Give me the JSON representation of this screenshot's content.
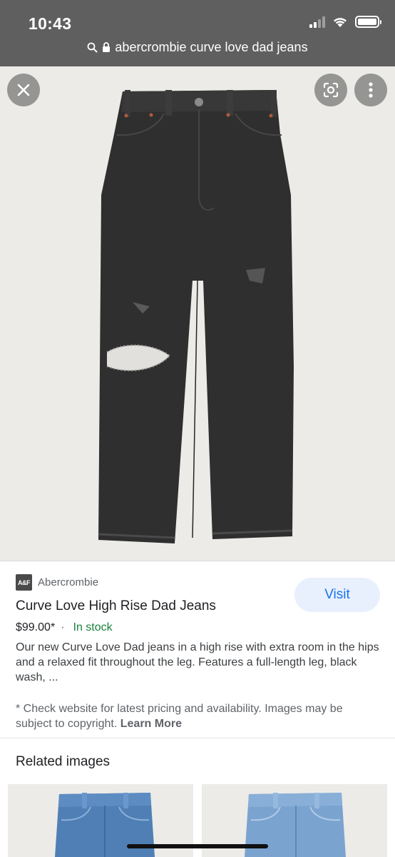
{
  "status_bar": {
    "time": "10:43"
  },
  "browser": {
    "url": "abercrombie curve love dad jeans"
  },
  "product": {
    "source_logo": "A&F",
    "source": "Abercrombie",
    "visit_label": "Visit",
    "title": "Curve Love High Rise Dad Jeans",
    "price": "$99.00*",
    "separator": "·",
    "availability": "In stock",
    "description": "Our new Curve Love Dad jeans in a high rise with extra room in the hips and a relaxed fit throughout the leg. Features a full-length leg, black wash, ...",
    "disclaimer": "* Check website for latest pricing and availability. Images may be subject to copyright.",
    "learn_more": "Learn More"
  },
  "related": {
    "title": "Related images"
  },
  "colors": {
    "accent": "#1a73e8",
    "in_stock": "#188038",
    "chrome": "#5f5f5f"
  }
}
